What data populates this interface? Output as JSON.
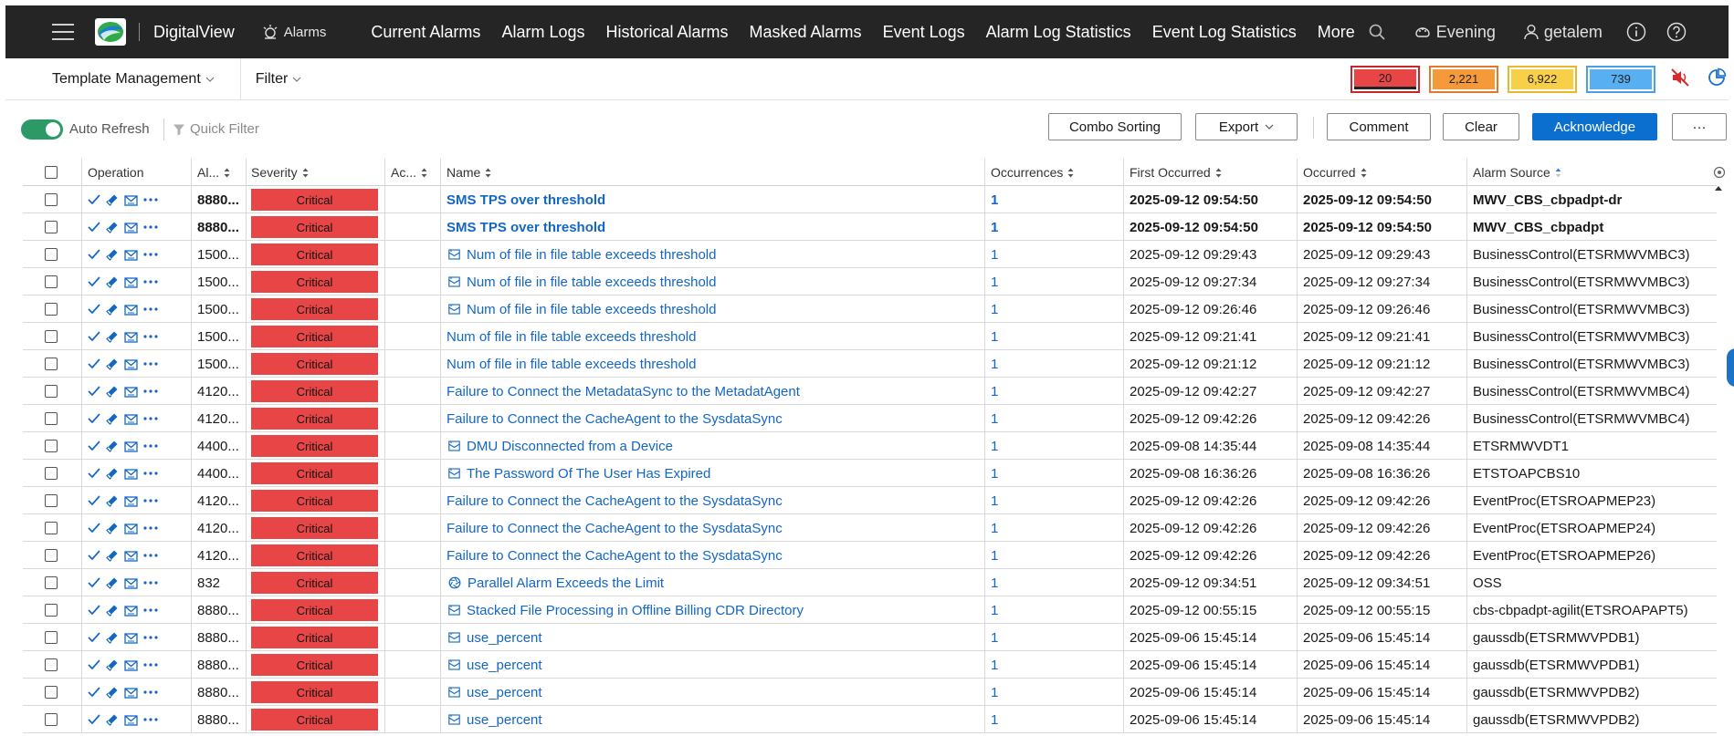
{
  "header": {
    "app_name": "DigitalView",
    "context_label": "Alarms",
    "nav": [
      "Current Alarms",
      "Alarm Logs",
      "Historical Alarms",
      "Masked Alarms",
      "Event Logs",
      "Alarm Log Statistics",
      "Event Log Statistics",
      "More"
    ],
    "theme_label": "Evening",
    "user_label": "getalem",
    "icons": [
      "menu-icon",
      "search-icon",
      "theme-icon",
      "user-icon",
      "info-icon",
      "help-icon"
    ]
  },
  "subbar": {
    "template_label": "Template Management",
    "filter_label": "Filter",
    "counters": [
      {
        "value": "20",
        "border": "#c8262b",
        "fill": "#e84646"
      },
      {
        "value": "2,221",
        "border": "#e5762a",
        "fill": "#f59a3a"
      },
      {
        "value": "6,922",
        "border": "#e8b82a",
        "fill": "#f8cf48"
      },
      {
        "value": "739",
        "border": "#4aa0e8",
        "fill": "#58b0f2"
      }
    ]
  },
  "toolbar": {
    "auto_refresh_label": "Auto Refresh",
    "auto_refresh_on": true,
    "quick_filter_label": "Quick Filter",
    "combo_sorting": "Combo Sorting",
    "export": "Export",
    "comment": "Comment",
    "clear": "Clear",
    "acknowledge": "Acknowledge",
    "more": "···",
    "accent_color": "#0a6fcf"
  },
  "table": {
    "columns": {
      "operation": "Operation",
      "alarm_id": "Al...",
      "severity": "Severity",
      "ack": "Ac...",
      "name": "Name",
      "occurrences": "Occurrences",
      "first_occurred": "First Occurred",
      "occurred": "Occurred",
      "alarm_source": "Alarm Source"
    },
    "rows": [
      {
        "id": "8880...",
        "severity": "Critical",
        "name": "SMS TPS over threshold",
        "icon": "",
        "occ": "1",
        "first": "2025-09-12 09:54:50",
        "last": "2025-09-12 09:54:50",
        "source": "MWV_CBS_cbpadpt-dr",
        "bold": true
      },
      {
        "id": "8880...",
        "severity": "Critical",
        "name": "SMS TPS over threshold",
        "icon": "",
        "occ": "1",
        "first": "2025-09-12 09:54:50",
        "last": "2025-09-12 09:54:50",
        "source": "MWV_CBS_cbpadpt",
        "bold": true
      },
      {
        "id": "1500...",
        "severity": "Critical",
        "name": "Num of file in file table exceeds threshold",
        "icon": "envelope-icon",
        "occ": "1",
        "first": "2025-09-12 09:29:43",
        "last": "2025-09-12 09:29:43",
        "source": "BusinessControl(ETSRMWVMBC3)",
        "bold": false
      },
      {
        "id": "1500...",
        "severity": "Critical",
        "name": "Num of file in file table exceeds threshold",
        "icon": "envelope-icon",
        "occ": "1",
        "first": "2025-09-12 09:27:34",
        "last": "2025-09-12 09:27:34",
        "source": "BusinessControl(ETSRMWVMBC3)",
        "bold": false
      },
      {
        "id": "1500...",
        "severity": "Critical",
        "name": "Num of file in file table exceeds threshold",
        "icon": "envelope-icon",
        "occ": "1",
        "first": "2025-09-12 09:26:46",
        "last": "2025-09-12 09:26:46",
        "source": "BusinessControl(ETSRMWVMBC3)",
        "bold": false
      },
      {
        "id": "1500...",
        "severity": "Critical",
        "name": "Num of file in file table exceeds threshold",
        "icon": "",
        "occ": "1",
        "first": "2025-09-12 09:21:41",
        "last": "2025-09-12 09:21:41",
        "source": "BusinessControl(ETSRMWVMBC3)",
        "bold": false
      },
      {
        "id": "1500...",
        "severity": "Critical",
        "name": "Num of file in file table exceeds threshold",
        "icon": "",
        "occ": "1",
        "first": "2025-09-12 09:21:12",
        "last": "2025-09-12 09:21:12",
        "source": "BusinessControl(ETSRMWVMBC3)",
        "bold": false
      },
      {
        "id": "4120...",
        "severity": "Critical",
        "name": "Failure to Connect the MetadataSync to the MetadatAgent",
        "icon": "",
        "occ": "1",
        "first": "2025-09-12 09:42:27",
        "last": "2025-09-12 09:42:27",
        "source": "BusinessControl(ETSRMWVMBC4)",
        "bold": false
      },
      {
        "id": "4120...",
        "severity": "Critical",
        "name": "Failure to Connect the CacheAgent to the SysdataSync",
        "icon": "",
        "occ": "1",
        "first": "2025-09-12 09:42:26",
        "last": "2025-09-12 09:42:26",
        "source": "BusinessControl(ETSRMWVMBC4)",
        "bold": false
      },
      {
        "id": "4400...",
        "severity": "Critical",
        "name": "DMU Disconnected from a Device",
        "icon": "envelope-icon",
        "occ": "1",
        "first": "2025-09-08 14:35:44",
        "last": "2025-09-08 14:35:44",
        "source": "ETSRMWVDT1",
        "bold": false
      },
      {
        "id": "4400...",
        "severity": "Critical",
        "name": "The Password Of The User Has Expired",
        "icon": "envelope-icon",
        "occ": "1",
        "first": "2025-09-08 16:36:26",
        "last": "2025-09-08 16:36:26",
        "source": "ETSTOAPCBS10",
        "bold": false
      },
      {
        "id": "4120...",
        "severity": "Critical",
        "name": "Failure to Connect the CacheAgent to the SysdataSync",
        "icon": "",
        "occ": "1",
        "first": "2025-09-12 09:42:26",
        "last": "2025-09-12 09:42:26",
        "source": "EventProc(ETSROAPMEP23)",
        "bold": false
      },
      {
        "id": "4120...",
        "severity": "Critical",
        "name": "Failure to Connect the CacheAgent to the SysdataSync",
        "icon": "",
        "occ": "1",
        "first": "2025-09-12 09:42:26",
        "last": "2025-09-12 09:42:26",
        "source": "EventProc(ETSROAPMEP24)",
        "bold": false
      },
      {
        "id": "4120...",
        "severity": "Critical",
        "name": "Failure to Connect the CacheAgent to the SysdataSync",
        "icon": "",
        "occ": "1",
        "first": "2025-09-12 09:42:26",
        "last": "2025-09-12 09:42:26",
        "source": "EventProc(ETSROAPMEP26)",
        "bold": false
      },
      {
        "id": "832",
        "severity": "Critical",
        "name": "Parallel Alarm Exceeds the Limit",
        "icon": "aperture-icon",
        "occ": "1",
        "first": "2025-09-12 09:34:51",
        "last": "2025-09-12 09:34:51",
        "source": "OSS",
        "bold": false
      },
      {
        "id": "8880...",
        "severity": "Critical",
        "name": "Stacked File Processing in Offline Billing CDR Directory",
        "icon": "envelope-icon",
        "occ": "1",
        "first": "2025-09-12 00:55:15",
        "last": "2025-09-12 00:55:15",
        "source": "cbs-cbpadpt-agilit(ETSROAPAPT5)",
        "bold": false
      },
      {
        "id": "8880...",
        "severity": "Critical",
        "name": "use_percent",
        "icon": "envelope-icon",
        "occ": "1",
        "first": "2025-09-06 15:45:14",
        "last": "2025-09-06 15:45:14",
        "source": "gaussdb(ETSRMWVPDB1)",
        "bold": false
      },
      {
        "id": "8880...",
        "severity": "Critical",
        "name": "use_percent",
        "icon": "envelope-icon",
        "occ": "1",
        "first": "2025-09-06 15:45:14",
        "last": "2025-09-06 15:45:14",
        "source": "gaussdb(ETSRMWVPDB1)",
        "bold": false
      },
      {
        "id": "8880...",
        "severity": "Critical",
        "name": "use_percent",
        "icon": "envelope-icon",
        "occ": "1",
        "first": "2025-09-06 15:45:14",
        "last": "2025-09-06 15:45:14",
        "source": "gaussdb(ETSRMWVPDB2)",
        "bold": false
      },
      {
        "id": "8880...",
        "severity": "Critical",
        "name": "use_percent",
        "icon": "envelope-icon",
        "occ": "1",
        "first": "2025-09-06 15:45:14",
        "last": "2025-09-06 15:45:14",
        "source": "gaussdb(ETSRMWVPDB2)",
        "bold": false
      }
    ],
    "critical_color": "#e84646",
    "link_color": "#1466c4"
  }
}
